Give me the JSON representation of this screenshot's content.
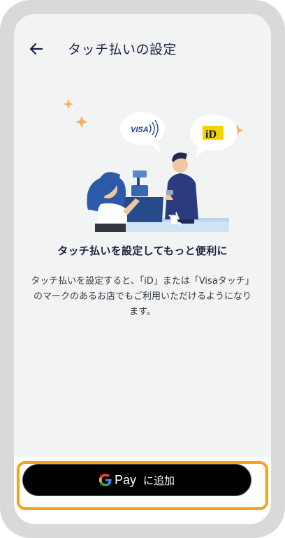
{
  "header": {
    "title": "タッチ払いの設定",
    "back_icon": "arrow-left-icon"
  },
  "illustration": {
    "visa_label": "VISA",
    "id_label": "iD"
  },
  "content": {
    "headline": "タッチ払いを設定してもっと便利に",
    "body": "タッチ払いを設定すると、「iD」または「Visaタッチ」のマークのあるお店でもご利用いただけるようになります。"
  },
  "action": {
    "pay_word": "Pay",
    "add_label": "に追加",
    "highlight_color": "#f5a11a"
  },
  "colors": {
    "accent_navy": "#1c2140",
    "button_bg": "#000000"
  }
}
